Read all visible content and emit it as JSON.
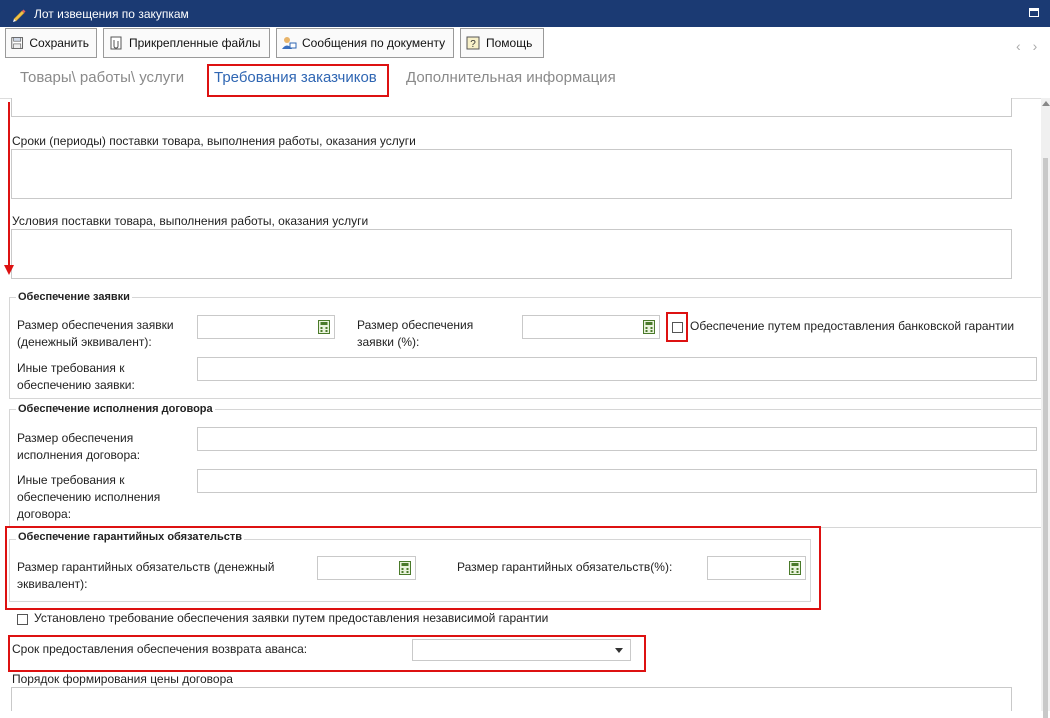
{
  "window": {
    "title": "Лот извещения по закупкам"
  },
  "toolbar": {
    "save": "Сохранить",
    "attachments": "Прикрепленные файлы",
    "messages": "Сообщения по документу",
    "help": "Помощь"
  },
  "nav": {
    "prev": "‹",
    "next": "›"
  },
  "tabs": [
    {
      "label": "Товары\\ работы\\ услуги",
      "active": false
    },
    {
      "label": "Требования заказчиков",
      "active": true
    },
    {
      "label": "Дополнительная информация",
      "active": false
    }
  ],
  "form": {
    "delivery_periods_label": "Сроки (периоды) поставки товара, выполнения работы, оказания услуги",
    "delivery_terms_label": "Условия поставки товара, выполнения работы, оказания услуги",
    "bid_security": {
      "title": "Обеспечение заявки",
      "amount_label_line1": "Размер обеспечения заявки",
      "amount_label_line2": "(денежный эквивалент):",
      "percent_label_line1": "Размер обеспечения",
      "percent_label_line2": "заявки (%):",
      "bank_guarantee_label": "Обеспечение путем предоставления банковской гарантии",
      "bank_guarantee_checked": false,
      "other_label_line1": "Иные требования к",
      "other_label_line2": "обеспечению заявки:"
    },
    "contract_security": {
      "title": "Обеспечение исполнения договора",
      "amount_label_line1": "Размер обеспечения",
      "amount_label_line2": "исполнения договора:",
      "other_label_line1": "Иные требования к",
      "other_label_line2": "обеспечению исполнения",
      "other_label_line3": "договора:"
    },
    "warranty": {
      "title": "Обеспечение гарантийных обязательств",
      "amount_label_line1": "Размер гарантийных обязательств (денежный",
      "amount_label_line2": "эквивалент):",
      "percent_label": "Размер гарантийных обязательств(%):"
    },
    "independent_guarantee_label": "Установлено требование обеспечения заявки путем предоставления независимой гарантии",
    "independent_guarantee_checked": false,
    "advance_return_label": "Срок предоставления обеспечения возврата аванса:",
    "advance_return_value": "",
    "price_formation_label": "Порядок формирования цены договора"
  },
  "colors": {
    "titlebar": "#1b3a73",
    "accent_tab": "#2f66b3",
    "highlight": "#dd1111"
  }
}
